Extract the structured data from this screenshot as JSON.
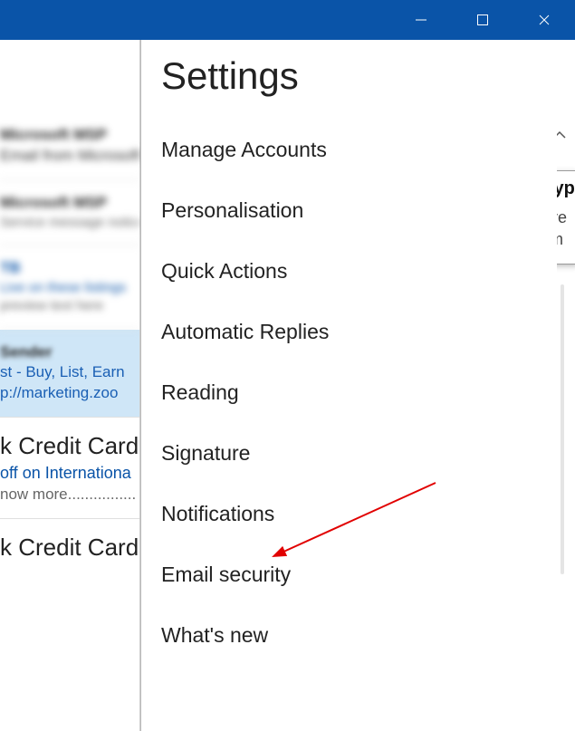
{
  "titlebar": {
    "minimize": "Minimize",
    "maximize": "Maximize",
    "close": "Close"
  },
  "settings": {
    "title": "Settings",
    "items": [
      "Manage Accounts",
      "Personalisation",
      "Quick Actions",
      "Automatic Replies",
      "Reading",
      "Signature",
      "Notifications",
      "Email security",
      "What's new"
    ]
  },
  "tooltip": {
    "title": "Hyp",
    "line1": "Cre",
    "line2": "em"
  },
  "mail_list": {
    "selected": {
      "line1": "st - Buy, List, Earn",
      "line2": "p://marketing.zoo"
    },
    "plain1": {
      "title": "k Credit Cards",
      "line2": "off on Internationa",
      "line3": "now more................"
    },
    "plain2": {
      "title": "k Credit Cards"
    }
  },
  "annotation": {
    "target": "Notifications"
  }
}
